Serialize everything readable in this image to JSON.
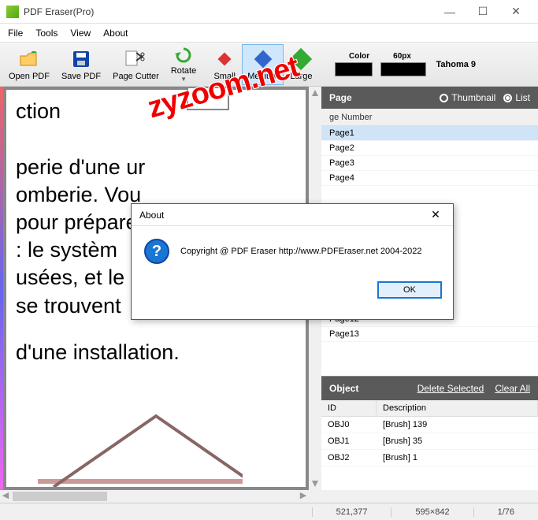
{
  "window": {
    "title": "PDF Eraser(Pro)"
  },
  "menu": {
    "file": "File",
    "tools": "Tools",
    "view": "View",
    "about": "About"
  },
  "toolbar": {
    "open": "Open PDF",
    "save": "Save PDF",
    "cutter": "Page Cutter",
    "rotate": "Rotate",
    "small": "Small",
    "medium": "Medium",
    "large": "Large",
    "color_label": "Color",
    "size_label": "60px",
    "font_label": "Tahoma 9"
  },
  "document": {
    "line1": "ction",
    "para": "perie d'une ur omberie. Vou pour préparen s : le systèm usées, et le sy t se trouvent",
    "line2": "d'une installation."
  },
  "watermark": "zyzoom.net",
  "pagepanel": {
    "header": "Page",
    "thumb": "Thumbnail",
    "list": "List",
    "col": "ge Number",
    "items": [
      "Page1",
      "Page2",
      "Page3",
      "Page4",
      "Page12",
      "Page13"
    ]
  },
  "objpanel": {
    "header": "Object",
    "delete": "Delete Selected",
    "clear": "Clear All",
    "id": "ID",
    "desc": "Description",
    "rows": [
      {
        "id": "OBJ0",
        "desc": "[Brush] 139"
      },
      {
        "id": "OBJ1",
        "desc": "[Brush] 35"
      },
      {
        "id": "OBJ2",
        "desc": "[Brush] 1"
      }
    ]
  },
  "status": {
    "coords": "521,377",
    "dim": "595×842",
    "pages": "1/76"
  },
  "dialog": {
    "title": "About",
    "text": "Copyright @ PDF Eraser http://www.PDFEraser.net 2004-2022",
    "ok": "OK"
  }
}
